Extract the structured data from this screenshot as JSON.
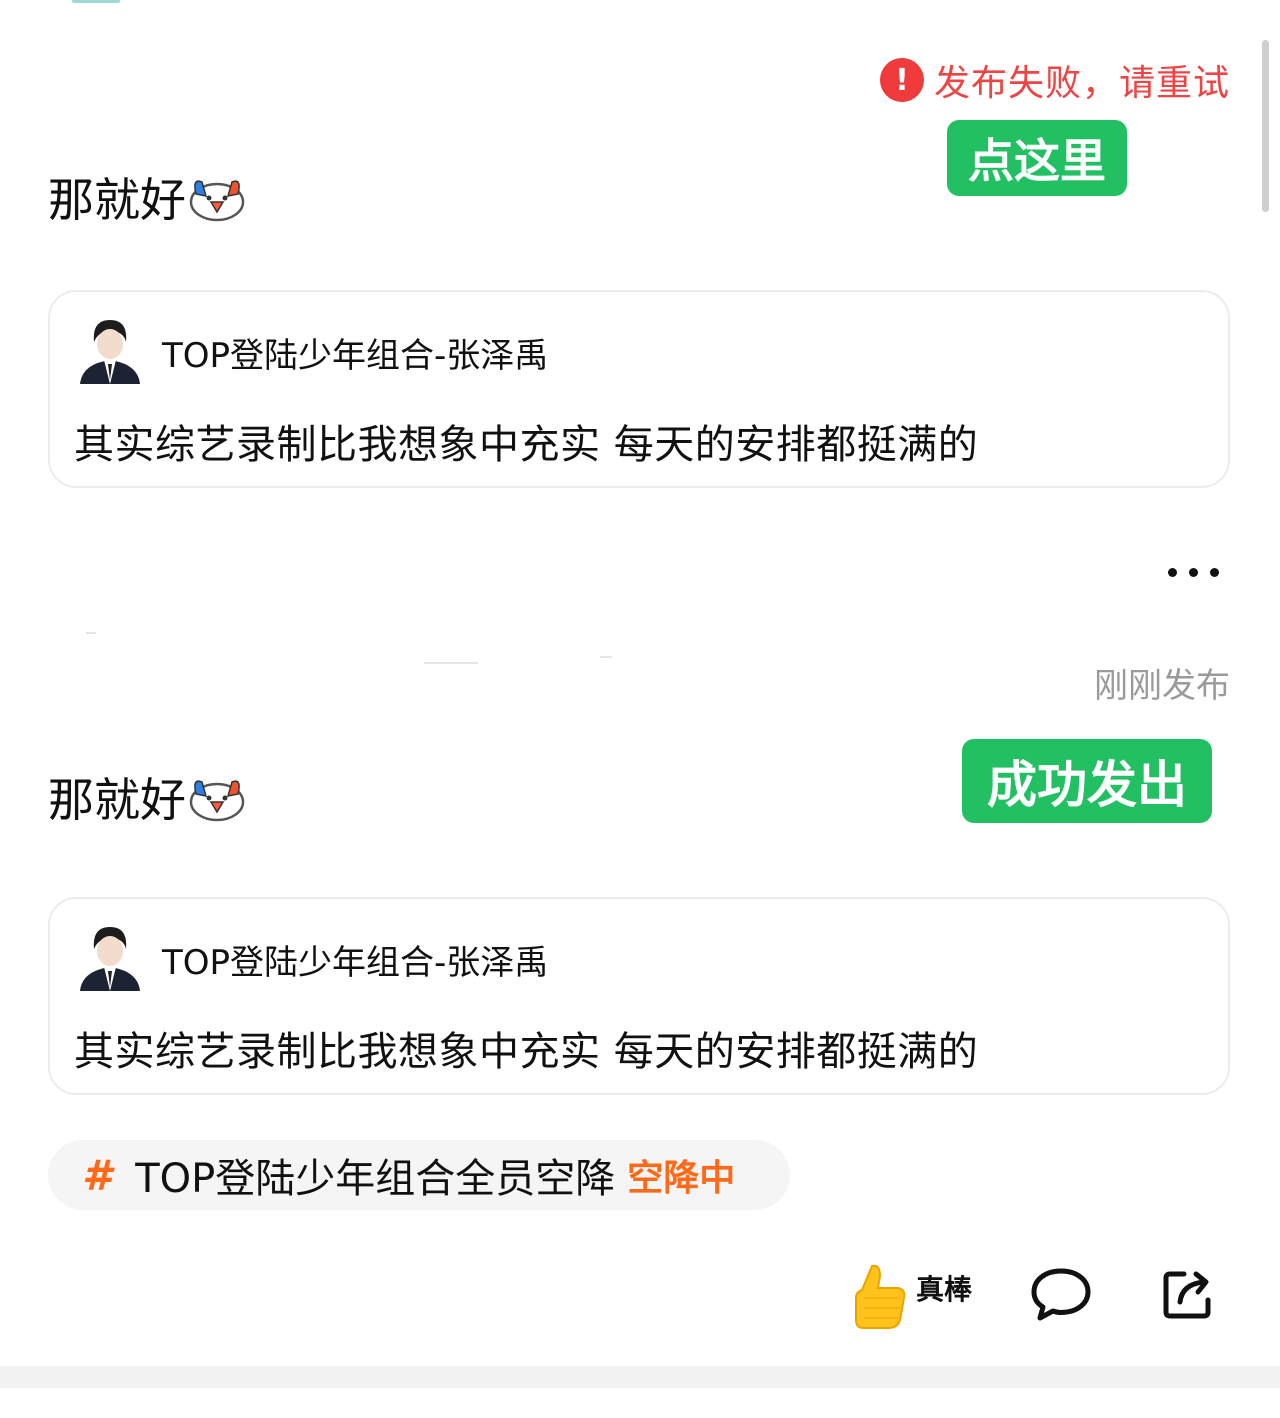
{
  "status": {
    "fail_icon": "!",
    "fail_text": "发布失败，请重试",
    "fail_color": "#ee4444",
    "timestamp": "刚刚发布"
  },
  "overlay_tags": {
    "tag_top": "点这里",
    "tag_bottom": "成功发出",
    "color": "#22c063"
  },
  "failed_post": {
    "text": "那就好",
    "emoji_icon": "crying-duck-emoji-icon",
    "quote": {
      "author": "TOP登陆少年组合-张泽禹",
      "body": "其实综艺录制比我想象中充实 每天的安排都挺满的"
    }
  },
  "published_post": {
    "text": "那就好",
    "emoji_icon": "crying-duck-emoji-icon",
    "quote": {
      "author": "TOP登陆少年组合-张泽禹",
      "body": "其实综艺录制比我想象中充实 每天的安排都挺满的"
    },
    "topic": {
      "hash": "#",
      "name": "TOP登陆少年组合全员空降",
      "status": "空降中",
      "accent": "#ff6a1a"
    },
    "actions": {
      "like_label": "真棒",
      "like_icon": "thumbs-up-icon",
      "comment_icon": "comment-bubble-icon",
      "share_icon": "share-icon"
    }
  },
  "more_icon": "more-dots-icon"
}
